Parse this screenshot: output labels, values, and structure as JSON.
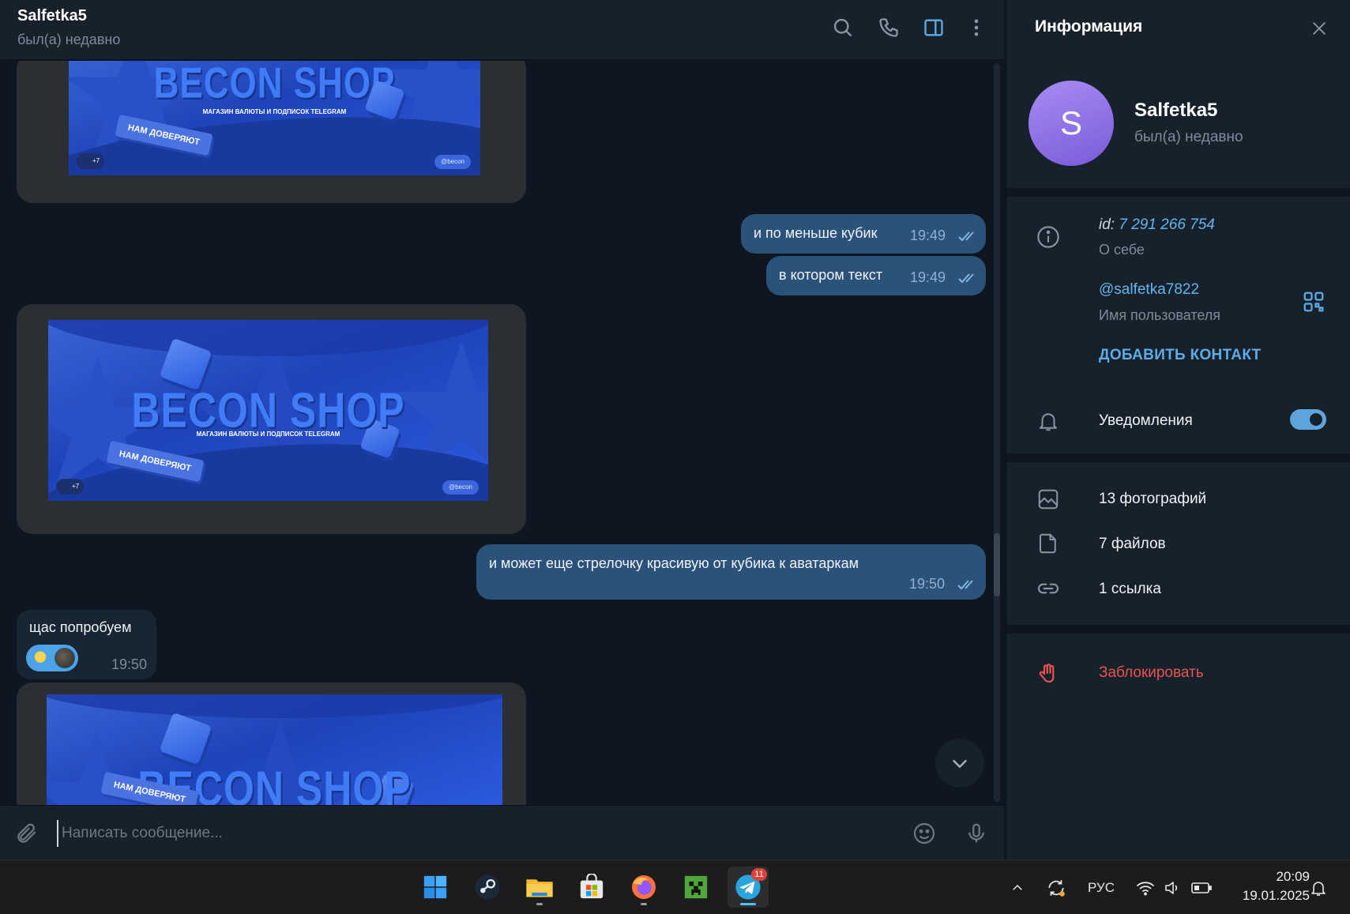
{
  "chat": {
    "title": "Salfetka5",
    "status": "был(а) недавно",
    "header_icons": [
      "search-icon",
      "phone-icon",
      "sidebar-toggle-icon",
      "more-vertical-icon"
    ],
    "banner": {
      "logo": "BECON SHOP",
      "subtitle": "МАГАЗИН ВАЛЮТЫ И ПОДПИСОК TELEGRAM",
      "tag": "НАМ ДОВЕРЯЮТ",
      "avatars_more": "+7",
      "handle": "@becon"
    },
    "messages": [
      {
        "type": "media",
        "direction": "in"
      },
      {
        "type": "text",
        "direction": "out",
        "text": "и по меньше кубик",
        "time": "19:49",
        "read": true
      },
      {
        "type": "text",
        "direction": "out",
        "text": "в котором текст",
        "time": "19:49",
        "read": true
      },
      {
        "type": "media",
        "direction": "in"
      },
      {
        "type": "text",
        "direction": "out",
        "text": "и может еще стрелочку красивую от кубика к аватаркам",
        "time": "19:50",
        "read": true
      },
      {
        "type": "text",
        "direction": "in",
        "text": "щас попробуем",
        "time": "19:50",
        "reaction": "reaction-with-avatar"
      },
      {
        "type": "media",
        "direction": "in"
      }
    ],
    "composer": {
      "placeholder": "Написать сообщение..."
    }
  },
  "info": {
    "title": "Информация",
    "avatar_letter": "S",
    "avatar_color": "#8e6ee6",
    "name": "Salfetka5",
    "status": "был(а) недавно",
    "id_label": "id:",
    "id_value": "7 291 266 754",
    "about_label": "О себе",
    "username": "@salfetka7822",
    "username_label": "Имя пользователя",
    "add_contact": "ДОБАВИТЬ КОНТАКТ",
    "notifications_label": "Уведомления",
    "notifications_on": true,
    "media": [
      {
        "icon": "photo-icon",
        "label": "13 фотографий"
      },
      {
        "icon": "file-icon",
        "label": "7 файлов"
      },
      {
        "icon": "link-icon",
        "label": "1 ссылка"
      }
    ],
    "block_label": "Заблокировать"
  },
  "taskbar": {
    "apps": [
      "windows-start-icon",
      "steam-icon",
      "file-explorer-icon",
      "microsoft-store-icon",
      "firefox-icon",
      "minecraft-icon",
      "telegram-icon"
    ],
    "telegram_badge": "11",
    "language": "РУС",
    "time": "20:09",
    "date": "19.01.2025"
  },
  "colors": {
    "bg": "#0e1621",
    "panel": "#17212b",
    "outgoing_bubble": "#2b5278",
    "incoming_bubble": "#182533",
    "accent": "#64b5ef",
    "danger": "#e85450"
  }
}
